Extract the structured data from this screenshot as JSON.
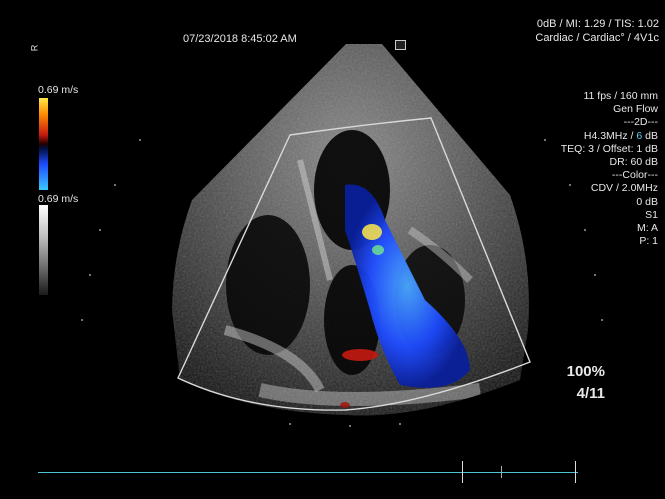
{
  "header": {
    "datetime": "07/23/2018 8:45:02 AM",
    "line1": "0dB / MI: 1.29 / TIS: 1.02",
    "line2": "Cardiac / Cardiac° / 4V1c"
  },
  "left_marker": "R",
  "velocity_scale": {
    "top_label": "0.69 m/s",
    "bottom_label": "0.69 m/s"
  },
  "parameters": [
    "11 fps / 160 mm",
    "Gen Flow",
    "---2D---",
    "H4.3MHz / 6 dB",
    "TEQ: 3 / Offset: 1 dB",
    "DR: 60 dB",
    "---Color---",
    "CDV / 2.0MHz",
    "0 dB",
    "S1",
    "M: A",
    "P: 1"
  ],
  "param_h_prefix": "H4.3MHz / ",
  "param_h_gain": "6",
  "param_h_suffix": " dB",
  "zoom_percent": "100%",
  "frame_counter": "4/11",
  "colors": {
    "timeline": "#4ec3d6",
    "accent": "#5fd0e6",
    "flow_blue": "#1e4bff",
    "flow_red": "#c41a10"
  }
}
